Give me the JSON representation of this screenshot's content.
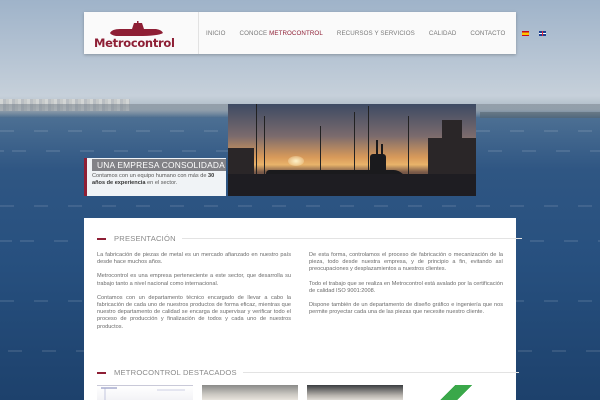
{
  "header": {
    "logo_text": "Metrocontrol",
    "nav": [
      {
        "label": "INICIO"
      },
      {
        "label_prefix": "CONOCE ",
        "label_accent": "METROCONTROL"
      },
      {
        "label": "RECURSOS Y SERVICIOS"
      },
      {
        "label": "CALIDAD"
      },
      {
        "label": "CONTACTO"
      }
    ],
    "languages": [
      "es-flag-icon",
      "en-flag-icon"
    ]
  },
  "hero": {
    "caption_title": "UNA EMPRESA CONSOLIDADA",
    "caption_text_before": "Contamos con un equipo humano con más de",
    "caption_text_bold": "30 años de experiencia",
    "caption_text_after": " en el sector."
  },
  "presentacion": {
    "title": "PRESENTACIÓN",
    "left_paragraphs": [
      "La fabricación de piezas de metal es un mercado afianzado en nuestro país desde hace muchos años.",
      "Metrocontrol es una empresa perteneciente a este sector, que desarrolla su trabajo tanto a nivel nacional como internacional.",
      "Contamos con un departamento técnico encargado de llevar a cabo la fabricación de cada uno de nuestros productos de forma eficaz, mientras que nuestro departamento de calidad se encarga de supervisar y verificar todo el proceso de producción y finalización de todos y cada uno de nuestros productos."
    ],
    "right_paragraphs": [
      "De esta forma, controlamos el proceso de fabricación o mecanización de la pieza, todo desde nuestra empresa, y de principio a fin, evitando así preocupaciones y desplazamientos a nuestros clientes.",
      "Todo el trabajo que se realiza en Metrocontrol está avalado por la certificación de calidad ISO 9001:2008.",
      "Dispone también de un departamento de diseño gráfico e ingeniería que nos permite proyectar cada una de las piezas que necesite nuestro cliente."
    ]
  },
  "destacados": {
    "title": "METROCONTROL DESTACADOS"
  },
  "colors": {
    "brand": "#8e1f35",
    "text": "#6a6a6a"
  }
}
